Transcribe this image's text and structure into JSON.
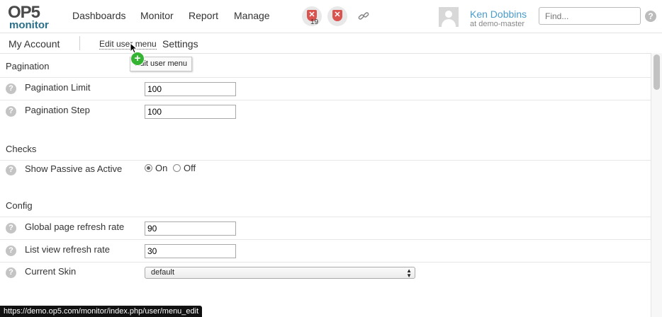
{
  "logo": {
    "top": "OP5",
    "bottom": "monitor"
  },
  "nav": {
    "items": [
      "Dashboards",
      "Monitor",
      "Report",
      "Manage"
    ]
  },
  "alerts": {
    "host_count": "19",
    "colors": {
      "alert": "#d9534f",
      "accent": "#4a9ccc"
    }
  },
  "user": {
    "name": "Ken Dobbins",
    "host": "at demo-master"
  },
  "search": {
    "placeholder": "Find...",
    "help": "?"
  },
  "subnav": {
    "title": "My Account",
    "edit_menu": "Edit user menu",
    "settings": "Settings"
  },
  "tooltip": {
    "text": "Edit user menu",
    "plus": "+"
  },
  "sections": {
    "pagination": {
      "title": "Pagination",
      "rows": [
        {
          "label": "Pagination Limit",
          "value": "100"
        },
        {
          "label": "Pagination Step",
          "value": "100"
        }
      ]
    },
    "checks": {
      "title": "Checks",
      "rows": [
        {
          "label": "Show Passive as Active",
          "options": [
            "On",
            "Off"
          ],
          "selected": "On"
        }
      ]
    },
    "config": {
      "title": "Config",
      "rows": [
        {
          "label": "Global page refresh rate",
          "value": "90"
        },
        {
          "label": "List view refresh rate",
          "value": "30"
        },
        {
          "label": "Current Skin",
          "value": "default"
        }
      ]
    }
  },
  "statusbar": {
    "url": "https://demo.op5.com/monitor/index.php/user/menu_edit"
  }
}
